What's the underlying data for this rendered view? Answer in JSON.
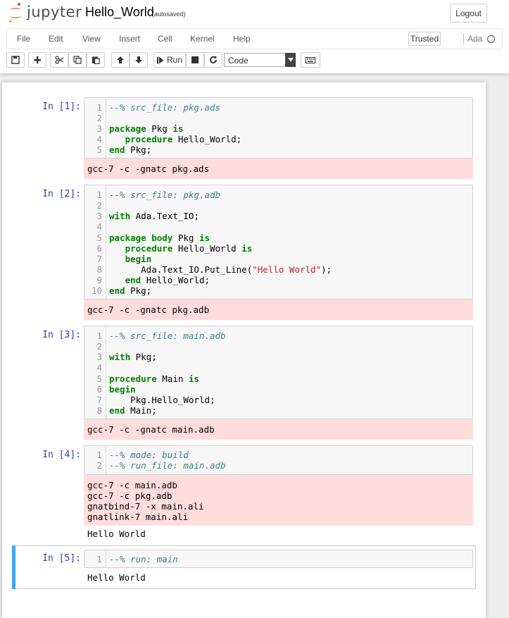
{
  "header": {
    "logo_text": "jupyter",
    "notebook_title": "Hello_World",
    "autosave_status": "(autosaved)",
    "logout_label": "Logout"
  },
  "menubar": {
    "items": [
      "File",
      "Edit",
      "View",
      "Insert",
      "Cell",
      "Kernel",
      "Help"
    ],
    "trusted_label": "Trusted",
    "kernel_name": "Ada"
  },
  "toolbar": {
    "run_label": "Run",
    "cell_type": "Code"
  },
  "cells": [
    {
      "prompt": "In [1]:",
      "code": [
        "--% src_file: pkg.ads",
        "",
        "package Pkg is",
        "   procedure Hello_World;",
        "end Pkg;"
      ],
      "stderr": "gcc-7 -c -gnatc pkg.ads",
      "stdout": ""
    },
    {
      "prompt": "In [2]:",
      "code": [
        "--% src_file: pkg.adb",
        "",
        "with Ada.Text_IO;",
        "",
        "package body Pkg is",
        "   procedure Hello_World is",
        "   begin",
        "      Ada.Text_IO.Put_Line(\"Hello World\");",
        "   end Hello_World;",
        "end Pkg;"
      ],
      "stderr": "gcc-7 -c -gnatc pkg.adb",
      "stdout": ""
    },
    {
      "prompt": "In [3]:",
      "code": [
        "--% src_file: main.adb",
        "",
        "with Pkg;",
        "",
        "procedure Main is",
        "begin",
        "    Pkg.Hello_World;",
        "end Main;"
      ],
      "stderr": "gcc-7 -c -gnatc main.adb",
      "stdout": ""
    },
    {
      "prompt": "In [4]:",
      "code": [
        "--% mode: build",
        "--% run_file: main.adb"
      ],
      "stderr": "gcc-7 -c main.adb\ngcc-7 -c pkg.adb\ngnatbind-7 -x main.ali\ngnatlink-7 main.ali",
      "stdout": "Hello World"
    },
    {
      "prompt": "In [5]:",
      "code": [
        "--% run: main"
      ],
      "stderr": "",
      "stdout": "Hello World"
    }
  ],
  "colors": {
    "prompt_in": "#303f9f",
    "keyword": "#008000",
    "comment": "#408080",
    "string": "#ba2121",
    "stderr_bg": "#ffdddd",
    "selected_bar": "#42a5f5"
  }
}
